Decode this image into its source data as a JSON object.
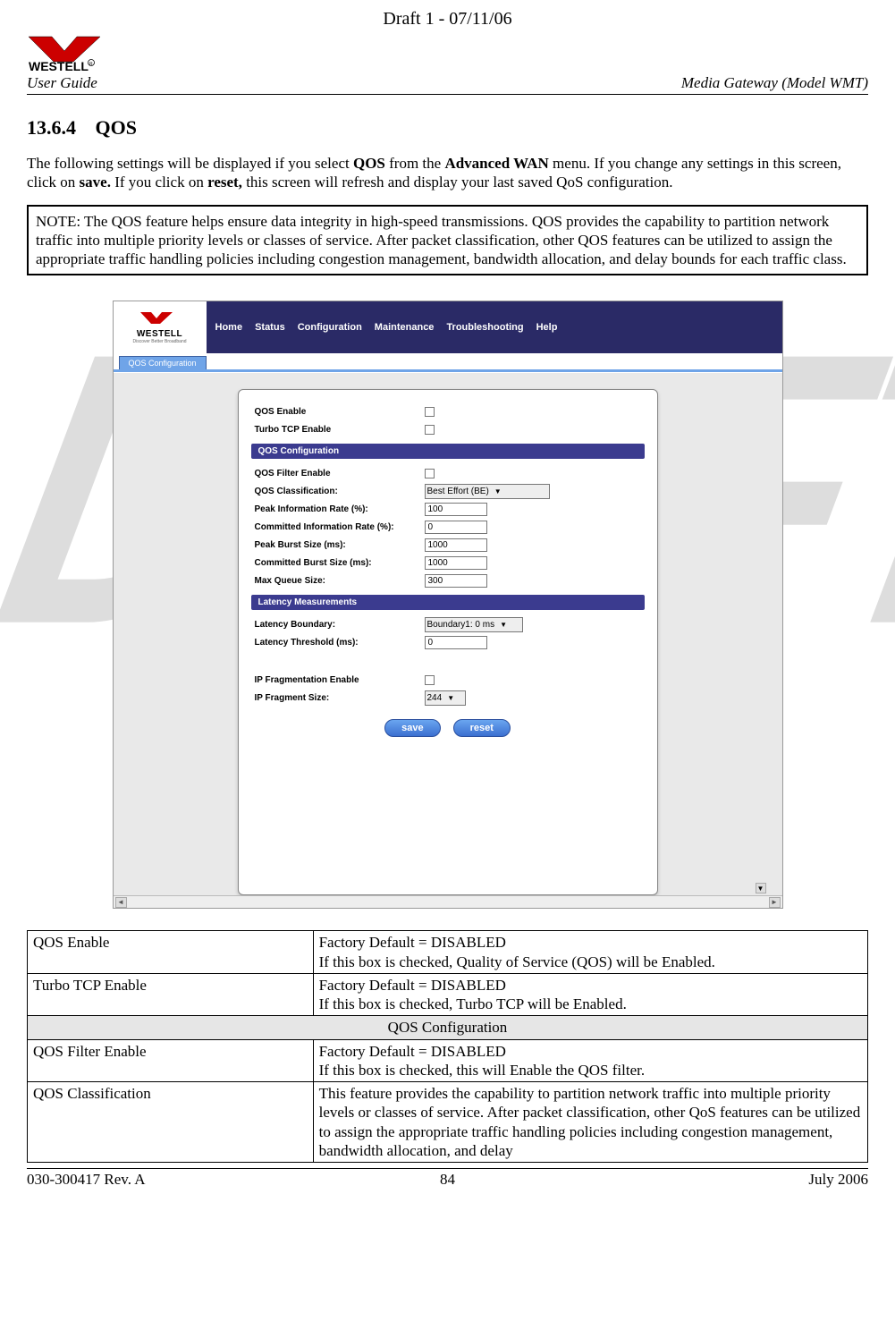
{
  "watermark": "DRAFT",
  "draft_header": "Draft 1 - 07/11/06",
  "logo_text": "WESTELL",
  "user_guide": "User Guide",
  "model_label": "Media Gateway (Model WMT)",
  "section_number": "13.6.4",
  "section_name": "QOS",
  "intro_prefix": "The following settings will be displayed if you select ",
  "intro_bold1": "QOS",
  "intro_mid1": " from the ",
  "intro_bold2": "Advanced WAN",
  "intro_mid2": " menu. If you change any settings in this screen, click on ",
  "intro_bold3": "save.",
  "intro_mid3": " If you click on ",
  "intro_bold4": "reset,",
  "intro_suffix": " this screen will refresh and display your last saved QoS configuration.",
  "note_text": "NOTE: The QOS feature helps ensure data integrity in high-speed transmissions. QOS provides the capability to partition network traffic into multiple priority levels or classes of service. After packet classification, other QOS features can be utilized to assign the appropriate traffic handling policies including congestion management, bandwidth allocation, and delay bounds for each traffic class.",
  "screenshot": {
    "logo_top": "WESTELL",
    "logo_tag": "Discover Better Broadband",
    "nav": [
      "Home",
      "Status",
      "Configuration",
      "Maintenance",
      "Troubleshooting",
      "Help"
    ],
    "tab": "QOS Configuration",
    "top_rows": [
      {
        "label": "QOS Enable"
      },
      {
        "label": "Turbo TCP Enable"
      }
    ],
    "sec1_title": "QOS Configuration",
    "sec1_rows": [
      {
        "label": "QOS Filter Enable",
        "type": "check"
      },
      {
        "label": "QOS Classification:",
        "type": "select",
        "value": "Best Effort (BE)"
      },
      {
        "label": "Peak Information Rate (%):",
        "type": "text",
        "value": "100"
      },
      {
        "label": "Committed Information Rate (%):",
        "type": "text",
        "value": "0"
      },
      {
        "label": "Peak Burst Size (ms):",
        "type": "text",
        "value": "1000"
      },
      {
        "label": "Committed Burst Size (ms):",
        "type": "text",
        "value": "1000"
      },
      {
        "label": "Max Queue Size:",
        "type": "text",
        "value": "300"
      }
    ],
    "sec2_title": "Latency Measurements",
    "sec2_rows": [
      {
        "label": "Latency Boundary:",
        "type": "select",
        "value": "Boundary1: 0 ms"
      },
      {
        "label": "Latency Threshold (ms):",
        "type": "text",
        "value": "0"
      }
    ],
    "sec3_rows": [
      {
        "label": "IP Fragmentation Enable",
        "type": "check"
      },
      {
        "label": "IP Fragment Size:",
        "type": "select_small",
        "value": "244"
      }
    ],
    "buttons": {
      "save": "save",
      "reset": "reset"
    }
  },
  "def_table": {
    "rows": [
      {
        "label": "QOS Enable",
        "desc": "Factory Default = DISABLED\nIf this box is checked, Quality of Service (QOS) will be Enabled."
      },
      {
        "label": "Turbo TCP Enable",
        "desc": "Factory Default = DISABLED\nIf this box is checked, Turbo TCP will be Enabled."
      }
    ],
    "section_hdr": "QOS Configuration",
    "rows2": [
      {
        "label": "QOS Filter Enable",
        "desc": "Factory Default = DISABLED\nIf this box is checked, this will Enable the QOS filter."
      },
      {
        "label": "QOS Classification",
        "desc": "This feature provides the capability to partition network traffic into multiple priority levels or classes of service. After packet classification, other QoS features can be utilized to assign the appropriate traffic handling policies including congestion management, bandwidth allocation, and delay"
      }
    ]
  },
  "footer": {
    "left": "030-300417 Rev. A",
    "center": "84",
    "right": "July 2006"
  }
}
